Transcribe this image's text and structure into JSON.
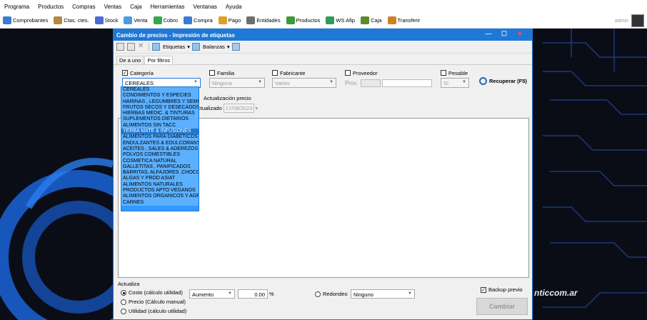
{
  "menu": [
    "Programa",
    "Productos",
    "Compras",
    "Ventas",
    "Caja",
    "Herramientas",
    "Ventanas",
    "Ayuda"
  ],
  "toolbar": [
    {
      "label": "Comprobantes",
      "color": "#3a7bd5"
    },
    {
      "label": "Ctas. ctes.",
      "color": "#b08a3e"
    },
    {
      "label": "Stock",
      "color": "#4a6bd6"
    },
    {
      "label": "Venta",
      "color": "#4c9be0"
    },
    {
      "label": "Cobro",
      "color": "#37a84a"
    },
    {
      "label": "Compra",
      "color": "#3a7bd5"
    },
    {
      "label": "Pago",
      "color": "#e0a020"
    },
    {
      "label": "Entidades",
      "color": "#6d6d6d"
    },
    {
      "label": "Productos",
      "color": "#3a9a3a"
    },
    {
      "label": "WS Afip",
      "color": "#2f9a5a"
    },
    {
      "label": "Caja",
      "color": "#5a8a2a"
    },
    {
      "label": "Transferir",
      "color": "#d08020"
    }
  ],
  "user": "admin",
  "brand": "nticcom.ar",
  "dialog": {
    "title": "Cambio de precios - Impresión de etiquetas",
    "etiquetas": "Etiquetas",
    "balanzas": "Balanzas",
    "tabs": [
      "De a uno",
      "Por filtros"
    ],
    "categoria_label": "Categoría",
    "categoria_value": "CEREALES",
    "familia_label": "Familia",
    "familia_value": "Ninguna",
    "fabricante_label": "Fabricante",
    "fabricante_value": "Varios",
    "proveedor_label": "Proveedor",
    "prov_label": "Prov.",
    "pesable_label": "Pesable",
    "pesable_value": "Sí",
    "recuperar": "Recuperar (F5)",
    "actualizacion_label": "Actualización precio",
    "actualizado_label": "ctualizado",
    "actualizado_date": "17/08/2023",
    "categories": [
      "CEREALES",
      "CONDIMENTOS Y  ESPECIES",
      "HARINAS , LEGUMBRES Y SEMI",
      "FRUTOS SECOS Y DESECADOS",
      " HIERBAS MEDIC. & TINTURAS",
      "SUPLEMENTOS DIETARIOS",
      "ALIMENTOS SIN TACC",
      "YERBA MATE & INFUSIONES",
      "ALIMENTOS PARA DIABETICOS",
      "ENDULZANTES & EDULCORANT",
      "ACEITES , SALES  & ADEREZOS",
      "POLVOS COMESTIBLES",
      "COSMETICA NATURAL",
      "GALLETITAS , PANIFICADOS",
      "BARRITAS, ALFAJORES ,CHOCO",
      "ALGAS Y PROD ASIAT",
      "ALIMENTOS NATURALES",
      "PRODUCTOS APTO VEGANOS",
      "ALIMENTOS ORGANICOS Y AGR",
      "CARNES"
    ],
    "selected_category_index": 7,
    "actualiza_label": "Actualiza",
    "costo_label": "Costo (cálculo utilidad)",
    "precio_label": "Precio (Cálculo manual)",
    "utilidad_label": "Utilidad (cálculo utilidad)",
    "aumento_value": "Aumento",
    "percent_value": "0.00",
    "percent_sign": "%",
    "redondeo_label": "Redondeo",
    "redondeo_value": "Ninguno",
    "backup_label": "Backup previo",
    "cambiar": "Cambiar"
  }
}
